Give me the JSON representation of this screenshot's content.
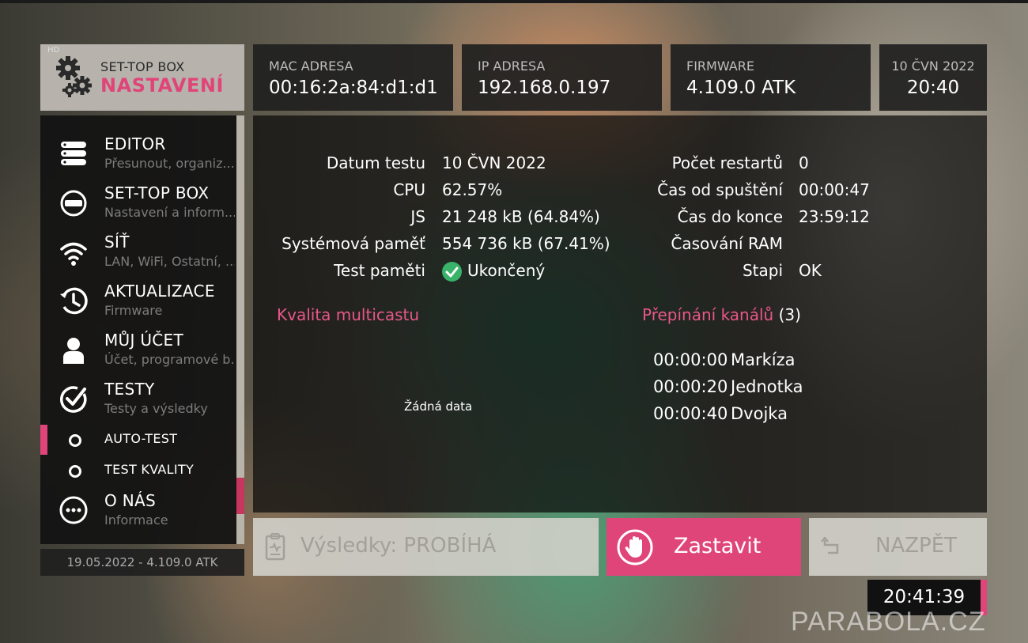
{
  "app": {
    "brand_line1": "SET-TOP BOX",
    "brand_line2": "NASTAVENÍ",
    "hd_badge": "HD"
  },
  "info": {
    "mac": {
      "label": "MAC ADRESA",
      "value": "00:16:2a:84:d1:d1"
    },
    "ip": {
      "label": "IP ADRESA",
      "value": "192.168.0.197"
    },
    "firmware": {
      "label": "FIRMWARE",
      "value": "4.109.0 ATK"
    },
    "datetime": {
      "date": "10 ČVN 2022",
      "time": "20:40"
    }
  },
  "sidebar": {
    "items": [
      {
        "title": "EDITOR",
        "subtitle": "Přesunout, organiz...",
        "icon": "list-icon"
      },
      {
        "title": "SET-TOP BOX",
        "subtitle": "Nastavení a inform...",
        "icon": "set-top-box-icon"
      },
      {
        "title": "SÍŤ",
        "subtitle": "LAN, WiFi, Ostatní, ...",
        "icon": "wifi-icon"
      },
      {
        "title": "AKTUALIZACE",
        "subtitle": "Firmware",
        "icon": "update-clock-icon"
      },
      {
        "title": "MŮJ ÚČET",
        "subtitle": "Účet, programové b...",
        "icon": "user-icon"
      },
      {
        "title": "TESTY",
        "subtitle": "Testy a výsledky",
        "icon": "test-check-icon"
      }
    ],
    "subitems": [
      {
        "title": "AUTO-TEST",
        "active": true
      },
      {
        "title": "TEST KVALITY",
        "active": false
      }
    ],
    "about": {
      "title": "O NÁS",
      "subtitle": "Informace",
      "icon": "more-icon"
    },
    "footer": "19.05.2022   -   4.109.0 ATK"
  },
  "stats": {
    "left": [
      {
        "label": "Datum testu",
        "value": "10 ČVN 2022"
      },
      {
        "label": "CPU",
        "value": "62.57%"
      },
      {
        "label": "JS",
        "value": "21 248 kB (64.84%)"
      },
      {
        "label": "Systémová paměť",
        "value": "554 736 kB (67.41%)"
      },
      {
        "label": "Test paměti",
        "value": "Ukončený"
      }
    ],
    "right": [
      {
        "label": "Počet restartů",
        "value": "0"
      },
      {
        "label": "Čas od spuštění",
        "value": "00:00:47"
      },
      {
        "label": "Čas do konce",
        "value": "23:59:12"
      },
      {
        "label": "Časování RAM",
        "value": ""
      },
      {
        "label": "Stapi",
        "value": "OK"
      }
    ]
  },
  "multicast": {
    "title": "Kvalita multicastu",
    "empty_text": "Žádná data"
  },
  "channels": {
    "title": "Přepínání kanálů",
    "count": "(3)",
    "rows": [
      {
        "time": "00:00:00",
        "name": "Markíza"
      },
      {
        "time": "00:00:20",
        "name": "Jednotka"
      },
      {
        "time": "00:00:40",
        "name": "Dvojka"
      }
    ]
  },
  "buttons": {
    "results": "Výsledky: PROBÍHÁ",
    "stop": "Zastavit",
    "back": "NAZPĚT"
  },
  "clock": "20:41:39",
  "watermark": "PARABOLA.CZ",
  "colors": {
    "accent": "#e0457a",
    "success": "#39b36a",
    "panel": "#141414"
  }
}
